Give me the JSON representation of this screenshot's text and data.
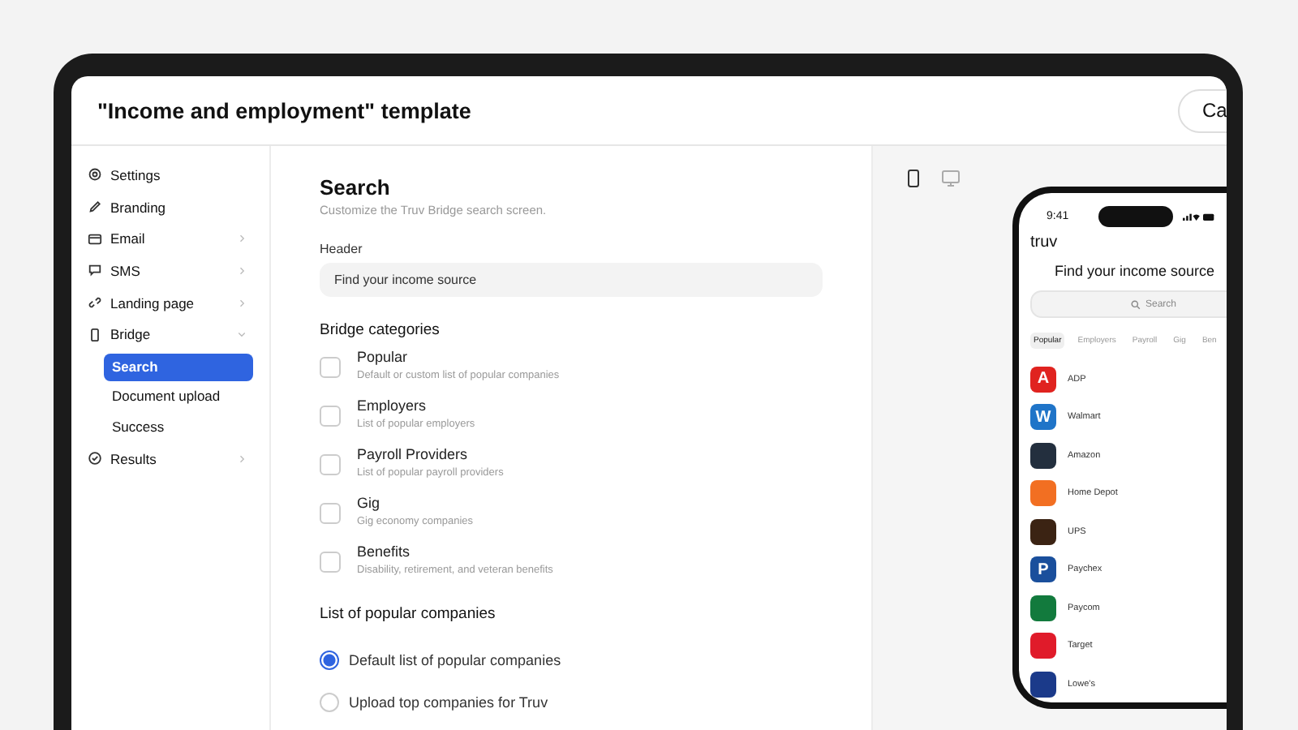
{
  "window": {
    "title": "\"Income and employment\" template",
    "action_button": "Ca"
  },
  "sidebar": {
    "items": [
      {
        "label": "Settings",
        "kind": "link"
      },
      {
        "label": "Branding",
        "kind": "link"
      },
      {
        "label": "Email",
        "kind": "group",
        "expanded": false
      },
      {
        "label": "SMS",
        "kind": "group",
        "expanded": false
      },
      {
        "label": "Landing page",
        "kind": "group",
        "expanded": false
      },
      {
        "label": "Bridge",
        "kind": "group",
        "expanded": true,
        "children": [
          {
            "label": "Search",
            "selected": true
          },
          {
            "label": "Document upload",
            "selected": false
          },
          {
            "label": "Success",
            "selected": false
          }
        ]
      },
      {
        "label": "Results",
        "kind": "group",
        "expanded": false
      }
    ]
  },
  "form": {
    "title": "Search",
    "subtitle": "Customize the Truv Bridge search screen.",
    "header_field": {
      "label": "Header",
      "value": "Find your income source"
    },
    "categories_title": "Bridge categories",
    "categories": [
      {
        "name": "Popular",
        "description": "Default or custom list of popular companies",
        "checked": false
      },
      {
        "name": "Employers",
        "description": "List of popular employers",
        "checked": false
      },
      {
        "name": "Payroll Providers",
        "description": "List of popular payroll providers",
        "checked": false
      },
      {
        "name": "Gig",
        "description": "Gig economy companies",
        "checked": false
      },
      {
        "name": "Benefits",
        "description": "Disability, retirement, and veteran benefits",
        "checked": false
      }
    ],
    "list_title": "List of popular companies",
    "list_options": [
      {
        "label": "Default list of popular companies",
        "selected": true
      },
      {
        "label": "Upload top companies for Truv",
        "selected": false
      }
    ]
  },
  "preview": {
    "devices": [
      {
        "kind": "phone",
        "selected": true
      },
      {
        "kind": "desktop",
        "selected": false
      }
    ],
    "phone": {
      "time": "9:41",
      "logo": "truv",
      "heading": "Find your income source",
      "search_placeholder": "Search",
      "tabs": [
        {
          "label": "Popular",
          "selected": true
        },
        {
          "label": "Employers",
          "selected": false
        },
        {
          "label": "Payroll",
          "selected": false
        },
        {
          "label": "Gig",
          "selected": false
        },
        {
          "label": "Ben",
          "selected": false
        }
      ],
      "companies": [
        {
          "name": "ADP",
          "color": "#e0231f",
          "glyph": "A"
        },
        {
          "name": "Walmart",
          "color": "#1f74c8",
          "glyph": "W"
        },
        {
          "name": "Amazon",
          "color": "#232f3e"
        },
        {
          "name": "Home Depot",
          "color": "#f26f22"
        },
        {
          "name": "UPS",
          "color": "#3b2313"
        },
        {
          "name": "Paychex",
          "color": "#1a4f9c",
          "glyph": "P"
        },
        {
          "name": "Paycom",
          "color": "#127a3d"
        },
        {
          "name": "Target",
          "color": "#e01b2a"
        },
        {
          "name": "Lowe's",
          "color": "#1b3a8a"
        }
      ]
    }
  }
}
